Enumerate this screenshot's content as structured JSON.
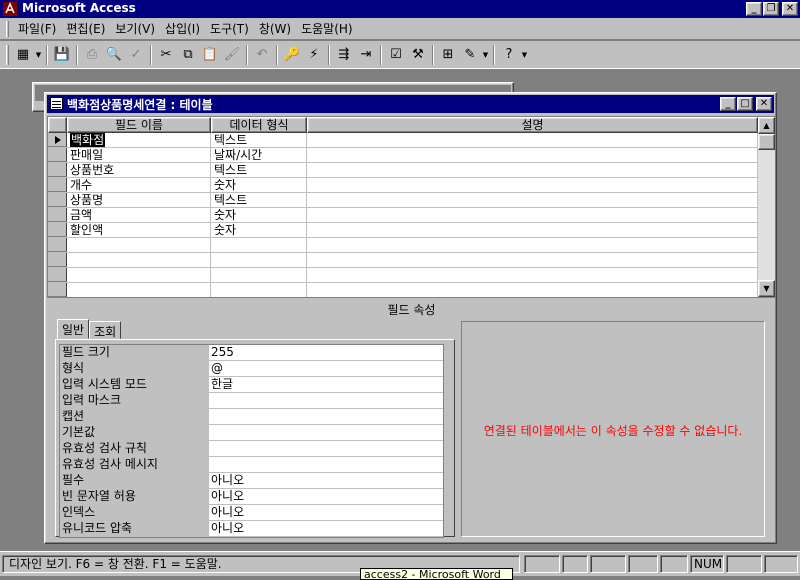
{
  "app": {
    "title": "Microsoft Access"
  },
  "menu": [
    "파일(F)",
    "편집(E)",
    "보기(V)",
    "삽입(I)",
    "도구(T)",
    "창(W)",
    "도움말(H)"
  ],
  "table_window": {
    "title": "백화점상품명세연결 : 테이블"
  },
  "grid": {
    "headers": {
      "selector": "",
      "name": "필드 이름",
      "type": "데이터 형식",
      "desc": "설명"
    },
    "rows": [
      {
        "name": "백화점",
        "type": "텍스트",
        "desc": ""
      },
      {
        "name": "판매일",
        "type": "날짜/시간",
        "desc": ""
      },
      {
        "name": "상품번호",
        "type": "텍스트",
        "desc": ""
      },
      {
        "name": "개수",
        "type": "숫자",
        "desc": ""
      },
      {
        "name": "상품명",
        "type": "텍스트",
        "desc": ""
      },
      {
        "name": "금액",
        "type": "숫자",
        "desc": ""
      },
      {
        "name": "할인액",
        "type": "숫자",
        "desc": ""
      }
    ]
  },
  "properties": {
    "section_label": "필드 속성",
    "tabs": [
      "일반",
      "조회"
    ],
    "rows": [
      {
        "label": "필드 크기",
        "value": "255"
      },
      {
        "label": "형식",
        "value": "@"
      },
      {
        "label": "입력 시스템 모드",
        "value": "한글"
      },
      {
        "label": "입력 마스크",
        "value": ""
      },
      {
        "label": "캡션",
        "value": ""
      },
      {
        "label": "기본값",
        "value": ""
      },
      {
        "label": "유효성 검사 규칙",
        "value": ""
      },
      {
        "label": "유효성 검사 메시지",
        "value": ""
      },
      {
        "label": "필수",
        "value": "아니오"
      },
      {
        "label": "빈 문자열 허용",
        "value": "아니오"
      },
      {
        "label": "인덱스",
        "value": "아니오"
      },
      {
        "label": "유니코드 압축",
        "value": "아니오"
      }
    ],
    "hint": "연결된 테이블에서는 이 속성을 수정할 수 없습니다."
  },
  "status": {
    "text": "디자인 보기.  F6 = 창 전환.  F1 = 도움말.",
    "num": "NUM"
  },
  "taskbar_tip": "access2 - Microsoft Word",
  "colors": {
    "title_bg": "#000080",
    "face": "#c0c0c0",
    "hint": "#ff0000"
  }
}
